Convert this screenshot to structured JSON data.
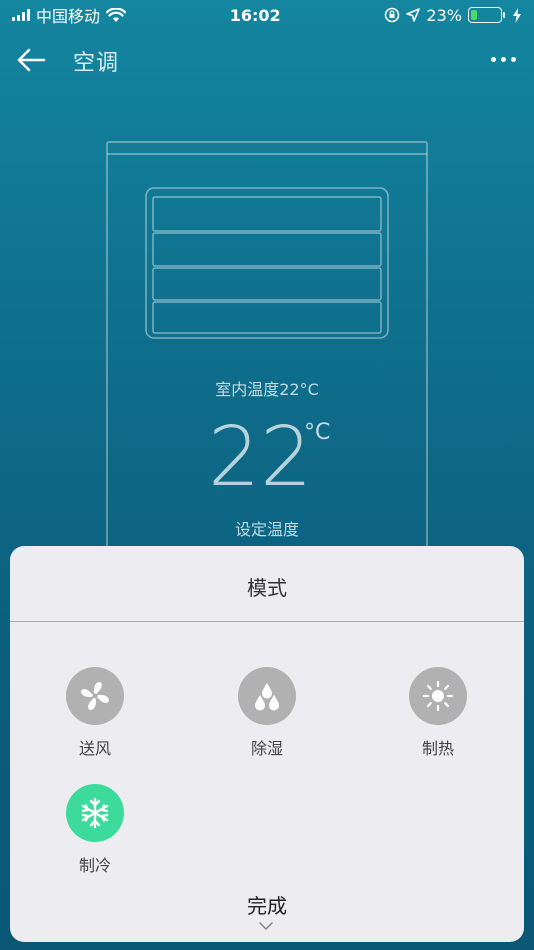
{
  "status_bar": {
    "carrier": "中国移动",
    "time": "16:02",
    "battery_percent": "23%",
    "battery_level": 0.23,
    "icons": [
      "signal-icon",
      "wifi-icon",
      "orientation-lock-icon",
      "location-icon",
      "battery-icon",
      "charging-icon"
    ]
  },
  "nav": {
    "title": "空调",
    "back_icon": "arrow-left-icon",
    "more_icon": "more-icon"
  },
  "display": {
    "indoor_temperature": "室内温度22°C",
    "set_temperature": "22",
    "unit": "°C",
    "set_temperature_label": "设定温度"
  },
  "mode_sheet": {
    "title": "模式",
    "modes": [
      {
        "label": "送风",
        "icon": "fan-icon",
        "active": false
      },
      {
        "label": "除湿",
        "icon": "water-drops-icon",
        "active": false
      },
      {
        "label": "制热",
        "icon": "sun-icon",
        "active": false
      },
      {
        "label": "制冷",
        "icon": "snowflake-icon",
        "active": true
      }
    ],
    "done_label": "完成"
  },
  "colors": {
    "background_top": "#1486a0",
    "background_bottom": "#0a5776",
    "sheet_bg": "#ececf1",
    "mode_inactive": "#b1b1b1",
    "mode_active": "#3ddb9b",
    "battery_fill": "#4cd964"
  }
}
